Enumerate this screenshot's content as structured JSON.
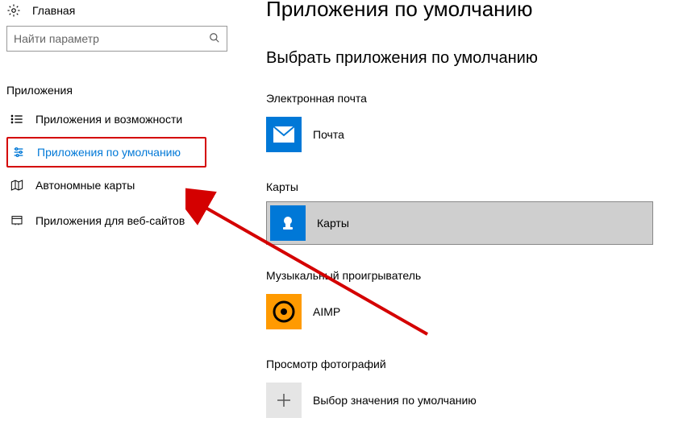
{
  "sidebar": {
    "home": "Главная",
    "search_placeholder": "Найти параметр",
    "section": "Приложения",
    "items": [
      {
        "label": "Приложения и возможности"
      },
      {
        "label": "Приложения по умолчанию"
      },
      {
        "label": "Автономные карты"
      },
      {
        "label": "Приложения для веб-сайтов"
      }
    ]
  },
  "main": {
    "title": "Приложения по умолчанию",
    "subtitle": "Выбрать приложения по умолчанию",
    "categories": [
      {
        "label": "Электронная почта",
        "app": "Почта",
        "tile": "mail"
      },
      {
        "label": "Карты",
        "app": "Карты",
        "tile": "maps",
        "selected": true
      },
      {
        "label": "Музыкальный проигрыватель",
        "app": "AIMP",
        "tile": "aimp"
      },
      {
        "label": "Просмотр фотографий",
        "app": "Выбор значения по умолчанию",
        "tile": "plus"
      }
    ]
  }
}
